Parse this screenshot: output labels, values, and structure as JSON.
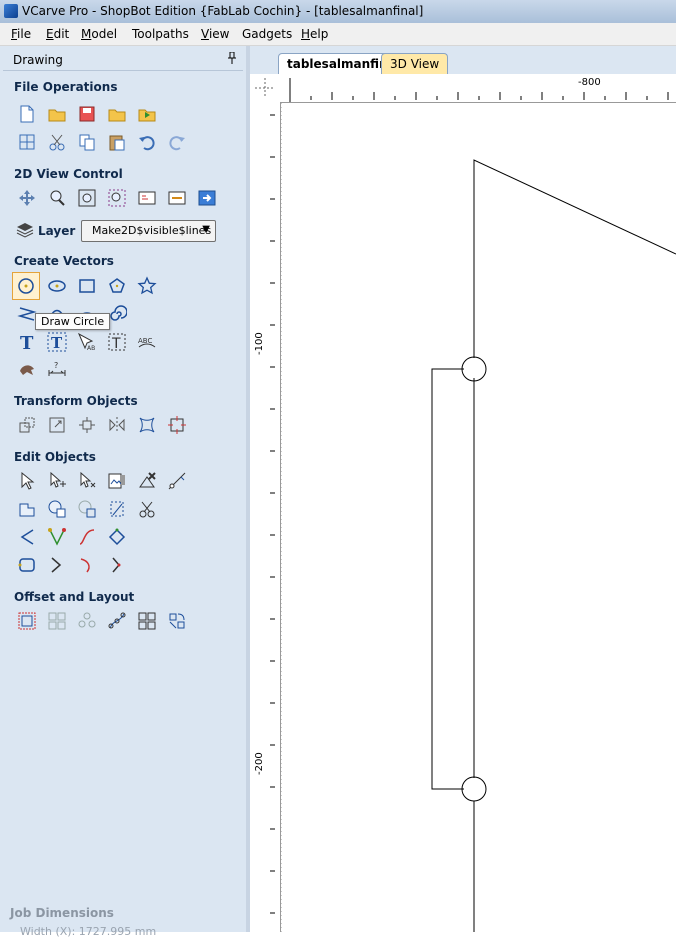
{
  "window": {
    "title": "VCarve Pro - ShopBot Edition {FabLab Cochin} - [tablesalmanfinal]"
  },
  "menu": [
    {
      "label": "File",
      "key": "F"
    },
    {
      "label": "Edit",
      "key": "E"
    },
    {
      "label": "Model",
      "key": "M"
    },
    {
      "label": "Toolpaths",
      "key": ""
    },
    {
      "label": "View",
      "key": "V"
    },
    {
      "label": "Gadgets",
      "key": ""
    },
    {
      "label": "Help",
      "key": "H"
    }
  ],
  "panel": {
    "title": "Drawing",
    "pin_icon": "pin-icon",
    "sections": {
      "file_operations": "File Operations",
      "view_control": "2D View Control",
      "create_vectors": "Create Vectors",
      "transform_objects": "Transform Objects",
      "edit_objects": "Edit Objects",
      "offset_layout": "Offset and Layout"
    },
    "layer": {
      "label": "Layer",
      "value": "Make2D$visible$lines"
    },
    "tooltip": "Draw Circle",
    "job_dimensions": "Job Dimensions",
    "job_width": "Width  (X): 1727.995 mm"
  },
  "tabs": [
    {
      "label": "tablesalmanfinal",
      "active": true
    },
    {
      "label": "3D View",
      "active": false
    }
  ],
  "rulers": {
    "top_label": "-800",
    "left_labels": [
      "-100",
      "-200"
    ]
  },
  "colors": {
    "panel_bg": "#dbe6f2",
    "section_title": "#102a4c",
    "tab_3d": "#ffe9a8"
  }
}
